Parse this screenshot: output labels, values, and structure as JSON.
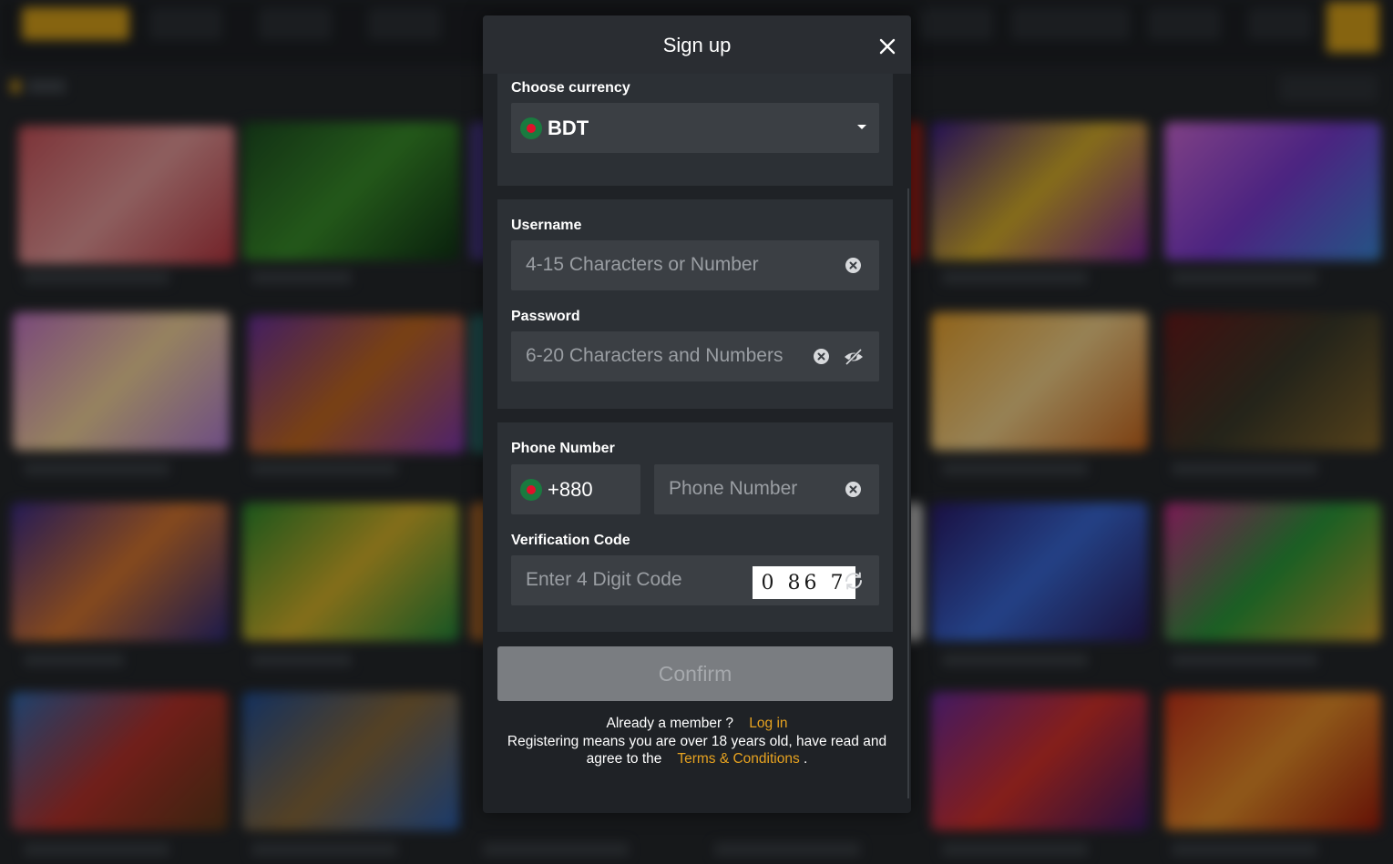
{
  "modal": {
    "title": "Sign up",
    "currency": {
      "label": "Choose currency",
      "value": "BDT",
      "flag_icon": "bangladesh-flag-icon"
    },
    "username": {
      "label": "Username",
      "placeholder": "4-15 Characters or Number"
    },
    "password": {
      "label": "Password",
      "placeholder": "6-20 Characters and Numbers"
    },
    "phone": {
      "label": "Phone Number",
      "country_code": "+880",
      "placeholder": "Phone Number"
    },
    "verification": {
      "label": "Verification Code",
      "placeholder": "Enter 4 Digit Code",
      "captcha": "0 86 7"
    },
    "confirm_label": "Confirm",
    "footer": {
      "member_text": "Already a member ?",
      "login_link": "Log in",
      "terms_text_1": "Registering means you are over 18 years old, have read and",
      "terms_text_2": "agree to the",
      "terms_link": "Terms & Conditions",
      "terms_end": "."
    }
  },
  "colors": {
    "accent": "#e6a220",
    "modal_bg": "#1f2226",
    "panel_bg": "#2c3035",
    "field_bg": "#3b3f44",
    "confirm_bg": "#7a7d81"
  }
}
